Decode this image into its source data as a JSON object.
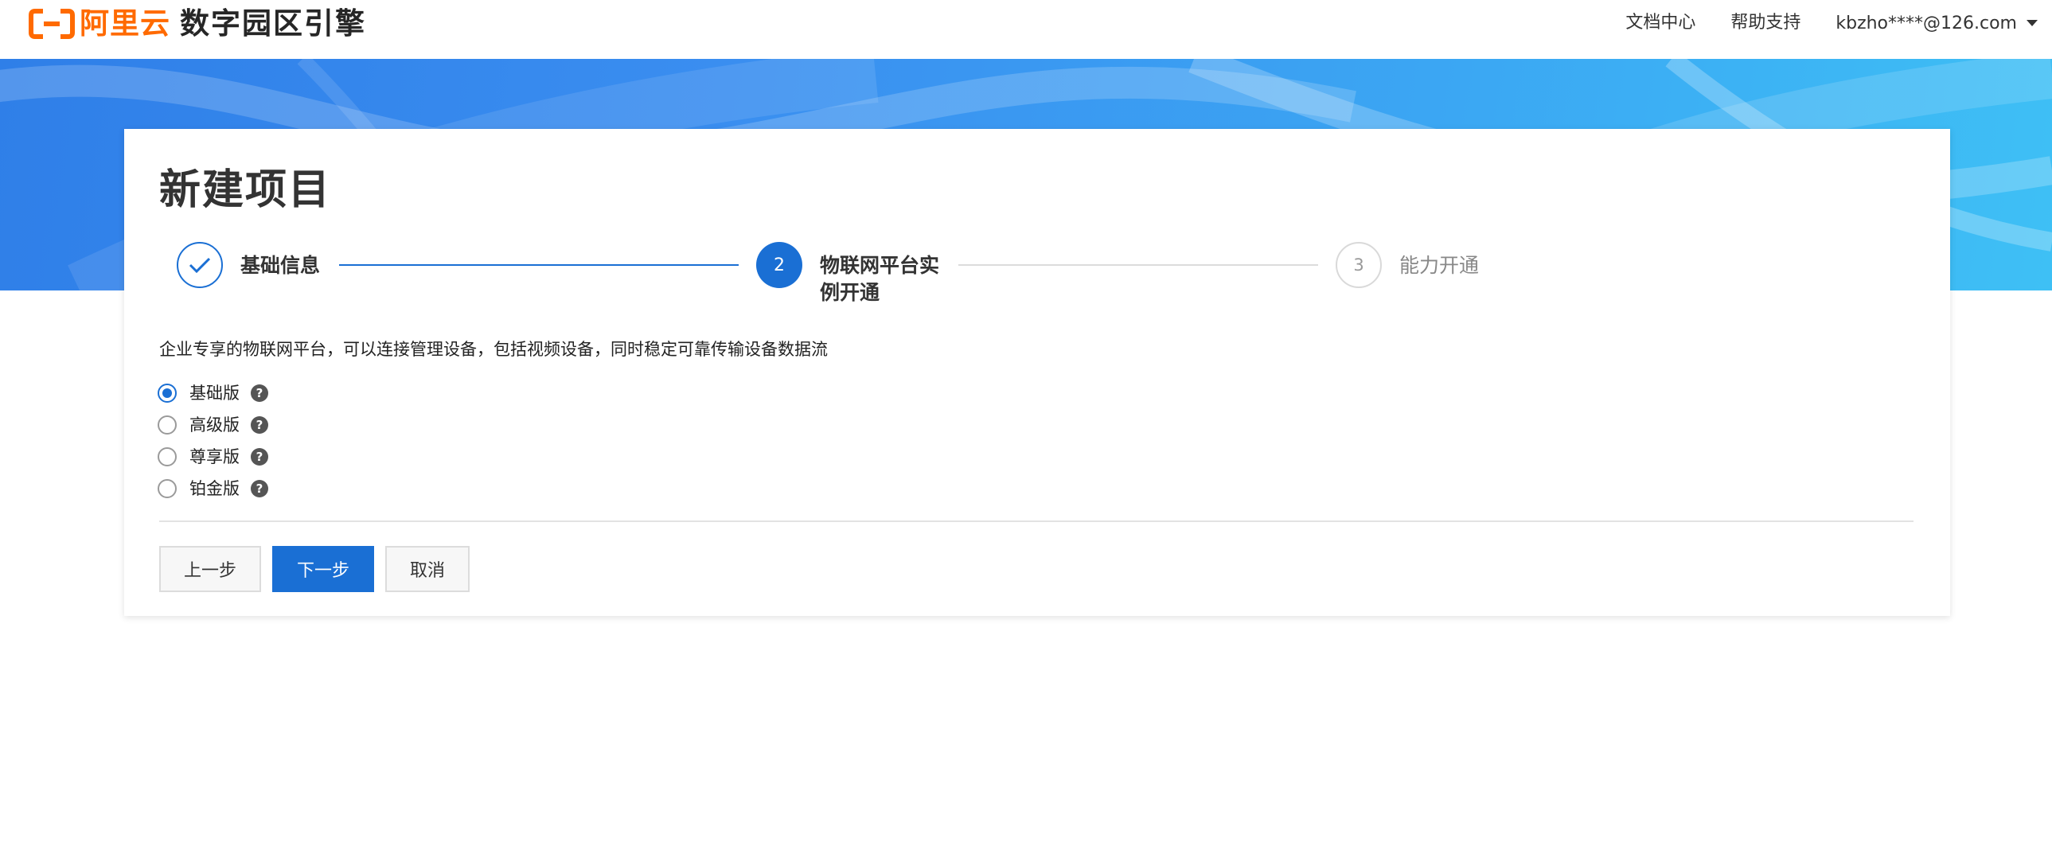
{
  "header": {
    "logo_text": "阿里云",
    "product_title": "数字园区引擎",
    "nav": {
      "docs": "文档中心",
      "help": "帮助支持",
      "user": "kbzho****@126.com"
    }
  },
  "page": {
    "title": "新建项目",
    "steps": [
      {
        "number": "1",
        "label": "基础信息",
        "status": "finished"
      },
      {
        "number": "2",
        "label": "物联网平台实例开通",
        "status": "current"
      },
      {
        "number": "3",
        "label": "能力开通",
        "status": "waiting"
      }
    ],
    "description": "企业专享的物联网平台，可以连接管理设备，包括视频设备，同时稳定可靠传输设备数据流",
    "editions": [
      {
        "label": "基础版",
        "selected": true
      },
      {
        "label": "高级版",
        "selected": false
      },
      {
        "label": "尊享版",
        "selected": false
      },
      {
        "label": "铂金版",
        "selected": false
      }
    ],
    "help_icon_glyph": "?",
    "buttons": {
      "prev": "上一步",
      "next": "下一步",
      "cancel": "取消"
    }
  },
  "colors": {
    "primary": "#1a6fd4",
    "brand": "#ff6a00",
    "banner": "#3a8ef0"
  },
  "icons": [
    "aliyun-logo-icon",
    "chevron-down-icon",
    "check-icon",
    "help-icon"
  ]
}
